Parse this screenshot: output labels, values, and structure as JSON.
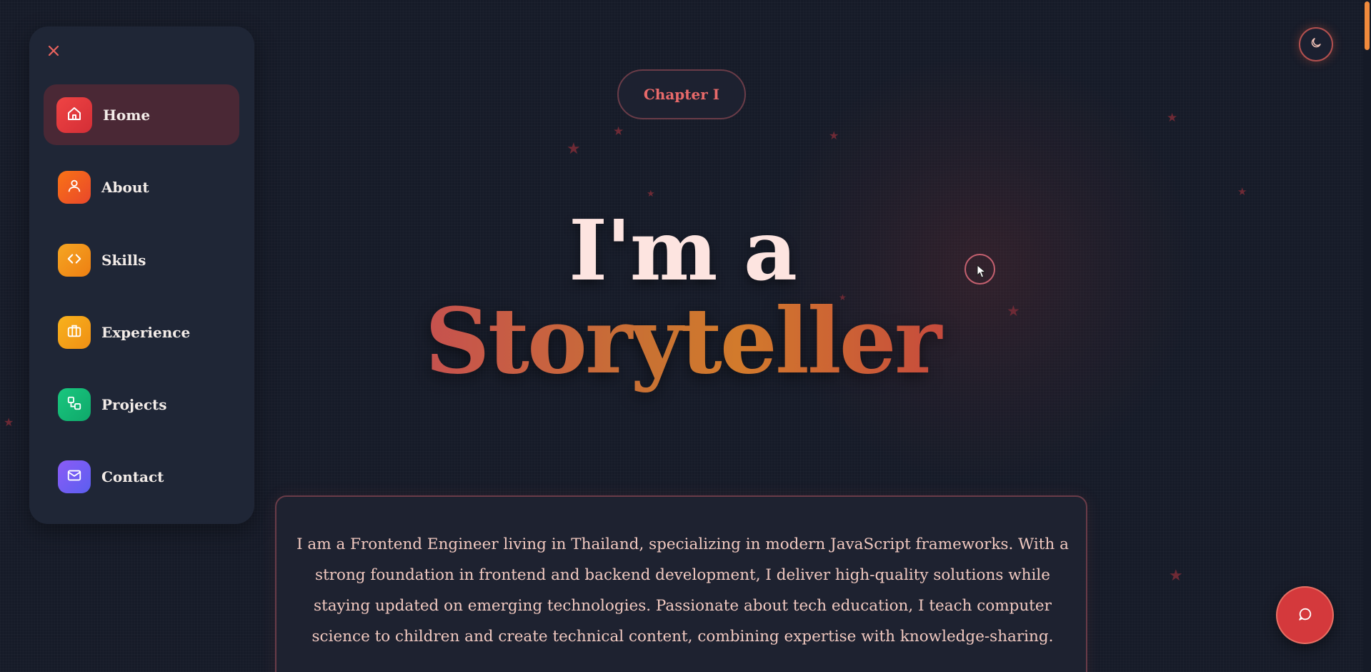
{
  "nav": {
    "items": [
      {
        "label": "Home",
        "icon": "home-icon",
        "color": "#e23b3b",
        "active": true
      },
      {
        "label": "About",
        "icon": "user-icon",
        "color": "#f0562d",
        "active": false
      },
      {
        "label": "Skills",
        "icon": "code-icon",
        "color": "#f19319",
        "active": false
      },
      {
        "label": "Experience",
        "icon": "briefcase-icon",
        "color": "#f5a31a",
        "active": false
      },
      {
        "label": "Projects",
        "icon": "flow-icon",
        "color": "#14b875",
        "active": false
      },
      {
        "label": "Contact",
        "icon": "mail-icon",
        "color": "#7a55e8",
        "active": false
      }
    ]
  },
  "hero": {
    "chapter_label": "Chapter I",
    "headline_line1": "I'm a",
    "headline_line2": "Storyteller"
  },
  "bio": {
    "text": "I am a Frontend Engineer living in Thailand, specializing in modern JavaScript frameworks. With a strong foundation in frontend and backend development, I deliver high-quality solutions while staying updated on emerging technologies. Passionate about tech education, I teach computer science to children and create technical content, combining expertise with knowledge-sharing."
  },
  "controls": {
    "theme_toggle_icon": "moon-icon",
    "chat_icon": "chat-bubble-icon",
    "close_icon": "close-icon"
  },
  "colors": {
    "accent": "#e23b3b",
    "accent_orange": "#f08a3c",
    "background": "#161b28",
    "panel": "#1f2636"
  }
}
